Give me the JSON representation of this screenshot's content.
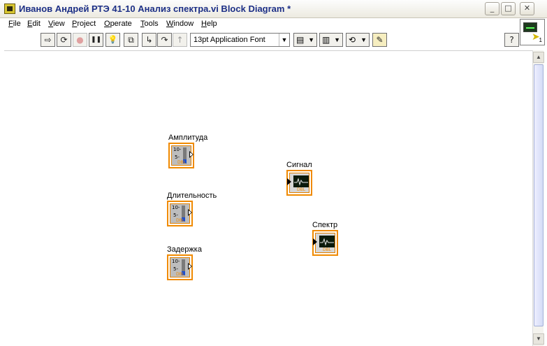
{
  "window": {
    "title": "Иванов Андрей РТЭ 41-10 Анализ спектра.vi Block Diagram *",
    "minimize_glyph": "_",
    "maximize_glyph": "□",
    "close_glyph": "✕"
  },
  "menu": {
    "items": [
      {
        "label": "File"
      },
      {
        "label": "Edit"
      },
      {
        "label": "View"
      },
      {
        "label": "Project"
      },
      {
        "label": "Operate"
      },
      {
        "label": "Tools"
      },
      {
        "label": "Window"
      },
      {
        "label": "Help"
      }
    ]
  },
  "toolbar": {
    "font_select_value": "13pt Application Font",
    "buttons": [
      {
        "icon": "run-arrow-icon",
        "glyph": "⇨"
      },
      {
        "icon": "run-continuously-icon",
        "glyph": "⟳"
      },
      {
        "icon": "abort-icon",
        "glyph": "●"
      },
      {
        "icon": "pause-icon",
        "glyph": "❚❚"
      },
      {
        "icon": "highlight-execution-icon",
        "glyph": "💡"
      },
      {
        "icon": "retain-wire-values-icon",
        "glyph": "⧉"
      },
      {
        "icon": "step-into-icon",
        "glyph": "↳"
      },
      {
        "icon": "step-over-icon",
        "glyph": "↷"
      },
      {
        "icon": "step-out-icon",
        "glyph": "↑"
      },
      {
        "icon": "align-objects-icon",
        "glyph": "▤"
      },
      {
        "icon": "distribute-objects-icon",
        "glyph": "▥"
      },
      {
        "icon": "reorder-icon",
        "glyph": "⟲"
      },
      {
        "icon": "clean-up-diagram-icon",
        "glyph": "✎"
      },
      {
        "icon": "help-icon",
        "glyph": "?"
      }
    ]
  },
  "connector_pane": {
    "label": "1"
  },
  "diagram": {
    "terminals": [
      {
        "id": "amplitude",
        "label": "Амплитуда",
        "kind": "numeric-control",
        "type": "DBL",
        "tick_hi": "10-",
        "tick_lo": "5-"
      },
      {
        "id": "duration",
        "label": "Длительность",
        "kind": "numeric-control",
        "type": "DBL",
        "tick_hi": "10-",
        "tick_lo": "5-"
      },
      {
        "id": "delay",
        "label": "Задержка",
        "kind": "numeric-control",
        "type": "DBL",
        "tick_hi": "10-",
        "tick_lo": "5-"
      },
      {
        "id": "signal",
        "label": "Сигнал",
        "kind": "graph-indicator",
        "type": "DBL"
      },
      {
        "id": "spectrum",
        "label": "Спектр",
        "kind": "graph-indicator",
        "type": "DBL"
      }
    ]
  },
  "colors": {
    "title_text": "#1c2f86",
    "terminal_border": "#f08a00",
    "slider_fill": "#1b4fd0"
  }
}
